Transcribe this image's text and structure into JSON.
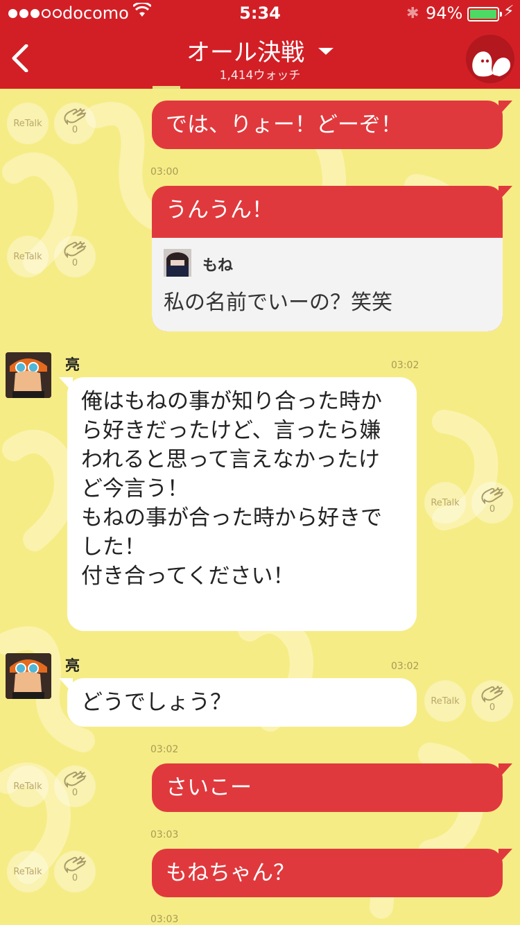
{
  "status_bar": {
    "carrier": "docomo",
    "time": "5:34",
    "battery": "94%",
    "battery_level": 0.94
  },
  "header": {
    "title": "オール決戦",
    "watchers": "1,414ウォッチ"
  },
  "actions": {
    "retalk_label": "ReTalk"
  },
  "messages": [
    {
      "side": "right",
      "text": "では、りょー！どーぞ！",
      "clap_count": "0"
    },
    {
      "side": "right",
      "time": "03:00",
      "text": "うんうん！",
      "quote": {
        "user": "もね",
        "text": "私の名前でいーの？笑笑"
      },
      "clap_count": "0"
    },
    {
      "side": "left",
      "user": "亮",
      "time": "03:02",
      "lines": [
        "俺はもねの事が知り合った時か",
        "ら好きだったけど、言ったら嫌",
        "われると思って言えなかったけ",
        "ど今言う！",
        "もねの事が合った時から好きで",
        "した！",
        "付き合ってください！"
      ],
      "clap_count": "0"
    },
    {
      "side": "left",
      "user": "亮",
      "time": "03:02",
      "text": "どうでしょう？",
      "clap_count": "0"
    },
    {
      "side": "right",
      "time": "03:02",
      "text": "さいこー",
      "clap_count": "0"
    },
    {
      "side": "right",
      "time": "03:03",
      "text": "もねちゃん？",
      "clap_count": "0"
    }
  ],
  "footer_time": "03:03",
  "colors": {
    "header_red": "#d21f26",
    "bubble_red": "#e0393d",
    "background_yellow": "#f6ec86",
    "battery_green": "#4cd964"
  }
}
